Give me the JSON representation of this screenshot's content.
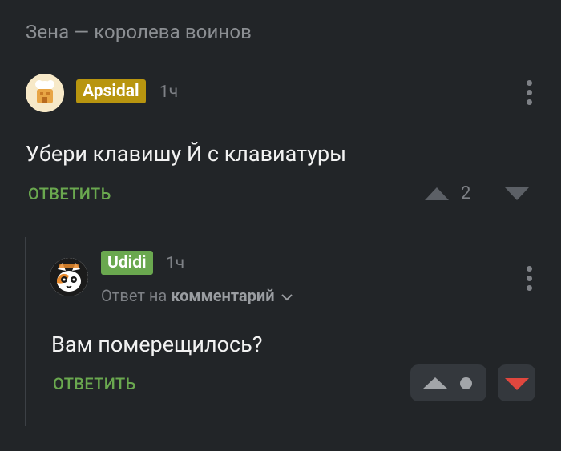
{
  "post": {
    "title": "Зена — королева воинов"
  },
  "comments": [
    {
      "author": "Apsidal",
      "time": "1ч",
      "badge_color": "#b8950f",
      "text": "Убери клавишу Й с клавиатуры",
      "reply_label": "ОТВЕТИТЬ",
      "rating": "2"
    },
    {
      "author": "Udidi",
      "time": "1ч",
      "badge_color": "#6aa84f",
      "reply_to_prefix": "Ответ на",
      "reply_to_target": "комментарий",
      "text": "Вам померещилось?",
      "reply_label": "ОТВЕТИТЬ"
    }
  ],
  "colors": {
    "background": "#222528",
    "accent_green": "#6aa84f",
    "downvote_active": "#e0473e"
  },
  "icons": [
    "upvote-icon",
    "downvote-icon",
    "more-vertical-icon",
    "chevron-down-icon"
  ]
}
